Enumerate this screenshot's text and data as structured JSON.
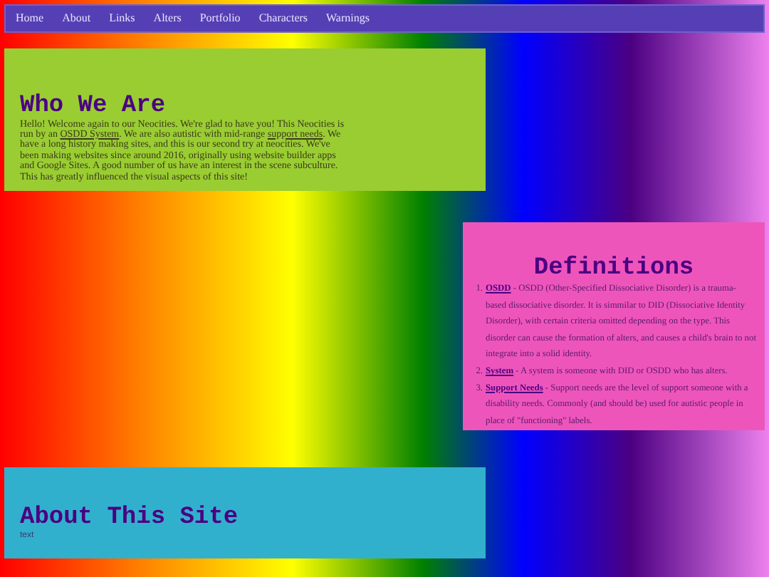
{
  "nav": {
    "items": [
      {
        "label": "Home"
      },
      {
        "label": "About"
      },
      {
        "label": "Links"
      },
      {
        "label": "Alters"
      },
      {
        "label": "Portfolio"
      },
      {
        "label": "Characters"
      },
      {
        "label": "Warnings"
      }
    ]
  },
  "who_we_are": {
    "title": "Who We Are",
    "body": [
      {
        "kind": "text",
        "text": "Hello! Welcome again to our Neocities. We're glad to have you! This Neocities is run by an "
      },
      {
        "kind": "link",
        "text": "OSDD System"
      },
      {
        "kind": "text",
        "text": ". We are also autistic with mid-range "
      },
      {
        "kind": "link",
        "text": "support needs"
      },
      {
        "kind": "text",
        "text": ". We have a long history making sites, and this is our second try at neocities. We've been making websites since around 2016, originally using website builder apps and Google Sites. A good number of us have an interest in the scene subculture. This has greatly influenced the visual aspects of this site!"
      }
    ]
  },
  "definitions": {
    "title": "Definitions",
    "items": [
      {
        "number": "1.",
        "term": "OSDD",
        "text": " - OSDD (Other-Specified Dissociative Disorder) is a trauma-based dissociative disorder. It is simmilar to DID (Dissociative Identity Disorder), with certain criteria omitted depending on the type. This disorder can cause the formation of alters, and causes a child's brain to not integrate into a solid identity."
      },
      {
        "number": "2.",
        "term": "System",
        "text": " - A system is someone with DID or OSDD who has alters."
      },
      {
        "number": "3.",
        "term": "Support Needs",
        "text": " - Support needs are the level of support someone with a disability needs. Commonly (and should be) used for autistic people in place of \"functioning\" labels."
      }
    ]
  },
  "about_this_site": {
    "title": "About This Site",
    "body": "text"
  }
}
